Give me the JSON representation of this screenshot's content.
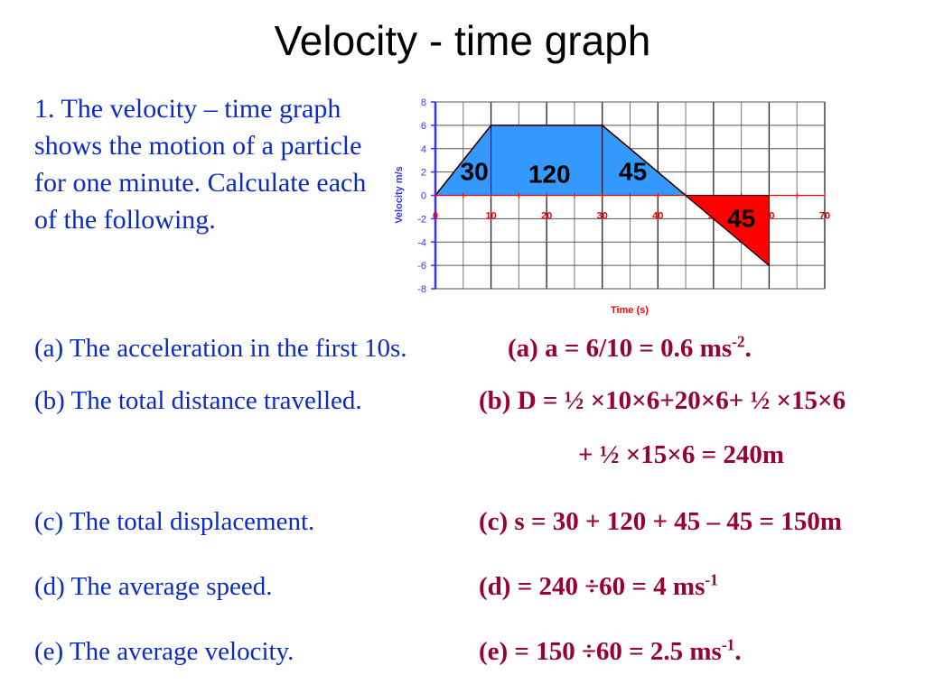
{
  "slide": {
    "title": "Velocity -  time graph",
    "intro": "1. The velocity – time graph shows the motion of a particle for one minute. Calculate each of the following."
  },
  "questions": [
    {
      "label": "(a) The acceleration in the first 10s."
    },
    {
      "label": "(b) The total distance travelled."
    },
    {
      "label": "(c) The total displacement."
    },
    {
      "label": "(d) The average speed."
    },
    {
      "label": "(e) The average velocity."
    }
  ],
  "answers": {
    "a": {
      "text": "(a)  a = 6/10 = 0.6 ms",
      "sup": "-2",
      "tail": "."
    },
    "b1": {
      "text": "(b) D = ½ ×10×6+20×6+ ½ ×15×6"
    },
    "b2": {
      "text": "+ ½ ×15×6 = 240m"
    },
    "c": {
      "text": "(c) s = 30 + 120 + 45 – 45 = 150m"
    },
    "d": {
      "text": "(d)  = 240 ÷60 = 4 ms",
      "sup": "-1",
      "tail": ""
    },
    "e": {
      "text": "(e)  = 150 ÷60 = 2.5 ms",
      "sup": "-1",
      "tail": "."
    }
  },
  "colors": {
    "question_text": "#0a2bc7",
    "answer_text": "#990033",
    "positive_area": "#3399ff",
    "negative_area": "#ff0000",
    "y_axis": "#3333ff",
    "x_axis": "#ff0000"
  },
  "chart_data": {
    "type": "line",
    "title": "",
    "xlabel": "Time (s)",
    "ylabel": "Velocity m/s",
    "xlim": [
      0,
      70
    ],
    "ylim": [
      -8,
      8
    ],
    "x_ticks": [
      0,
      10,
      20,
      30,
      40,
      50,
      60,
      70
    ],
    "x_tick_labels": [
      "0",
      "10",
      "20",
      "30",
      "40",
      "50",
      "60",
      "70"
    ],
    "y_ticks": [
      -8,
      -6,
      -4,
      -2,
      0,
      2,
      4,
      6,
      8
    ],
    "y_tick_labels": [
      "-8",
      "-6",
      "-4",
      "-2",
      "0",
      "2",
      "4",
      "6",
      "8"
    ],
    "grid": true,
    "grid_step_x": 5,
    "grid_step_y": 2,
    "series": [
      {
        "name": "velocity",
        "x": [
          0,
          10,
          30,
          45,
          60
        ],
        "y": [
          0,
          6,
          6,
          0,
          -6
        ]
      }
    ],
    "areas": [
      {
        "name": "area-1",
        "points": [
          [
            0,
            0
          ],
          [
            10,
            6
          ],
          [
            10,
            0
          ]
        ],
        "value_label": "30",
        "label_at": [
          7,
          1.3
        ],
        "fill": "positive"
      },
      {
        "name": "area-2",
        "points": [
          [
            10,
            0
          ],
          [
            10,
            6
          ],
          [
            30,
            6
          ],
          [
            30,
            0
          ]
        ],
        "value_label": "120",
        "label_at": [
          20.5,
          1.1
        ],
        "fill": "positive"
      },
      {
        "name": "area-3",
        "points": [
          [
            30,
            0
          ],
          [
            30,
            6
          ],
          [
            45,
            0
          ]
        ],
        "value_label": "45",
        "label_at": [
          35.5,
          1.3
        ],
        "fill": "positive"
      },
      {
        "name": "area-4",
        "points": [
          [
            45,
            0
          ],
          [
            60,
            0
          ],
          [
            60,
            -6
          ]
        ],
        "value_label": "45",
        "label_at": [
          55,
          -2.7
        ],
        "fill": "negative"
      }
    ]
  }
}
